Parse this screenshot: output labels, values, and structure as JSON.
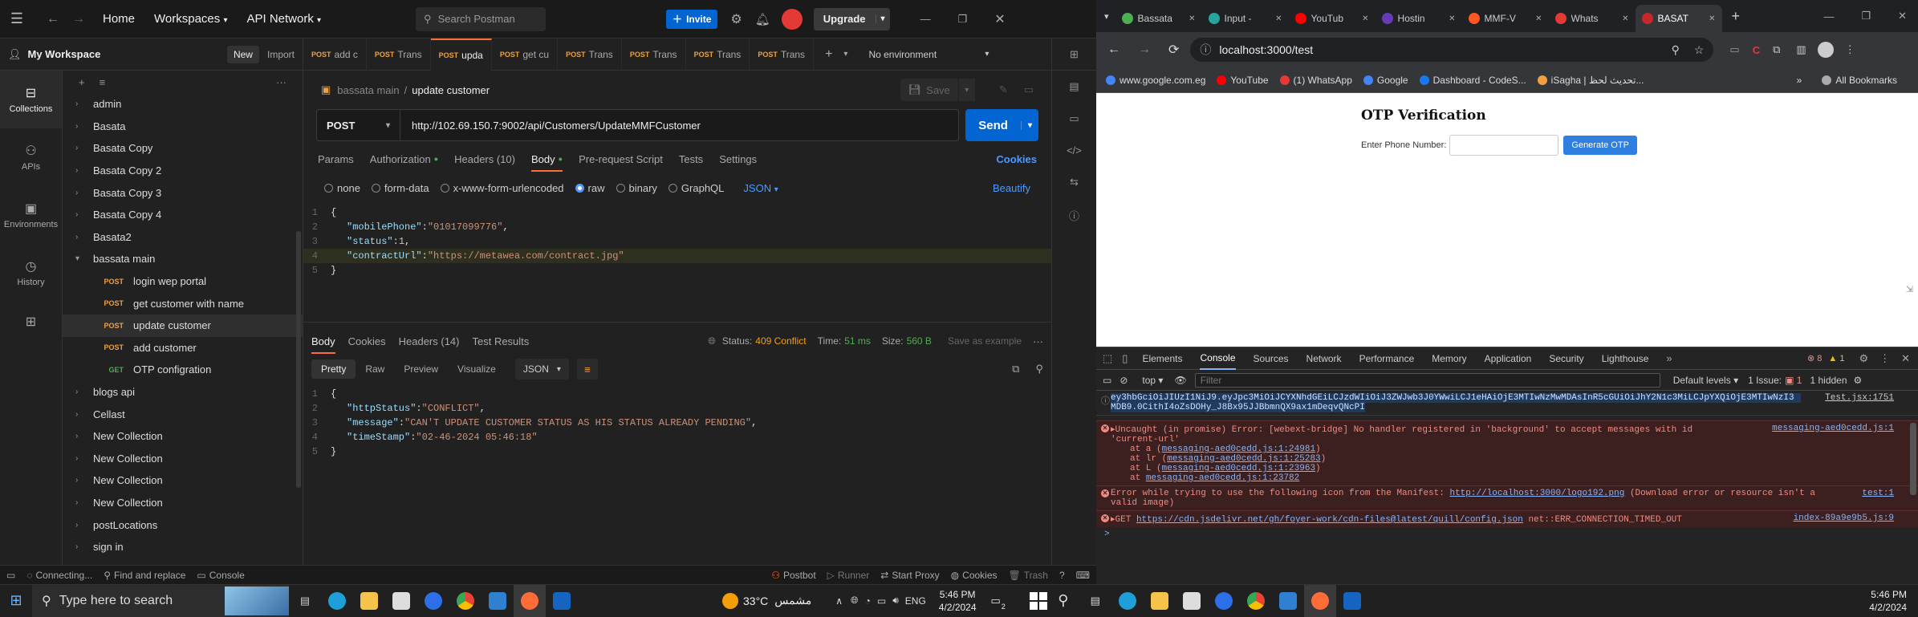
{
  "postman": {
    "nav": {
      "home": "Home",
      "workspaces": "Workspaces",
      "api_network": "API Network",
      "search_placeholder": "Search Postman",
      "invite": "Invite",
      "upgrade": "Upgrade"
    },
    "workspace": {
      "name": "My Workspace",
      "new": "New",
      "import": "Import",
      "environment": "No environment"
    },
    "tabs": [
      {
        "method": "POST",
        "label": "add c"
      },
      {
        "method": "POST",
        "label": "Trans"
      },
      {
        "method": "POST",
        "label": "upda"
      },
      {
        "method": "POST",
        "label": "get cu"
      },
      {
        "method": "POST",
        "label": "Trans"
      },
      {
        "method": "POST",
        "label": "Trans"
      },
      {
        "method": "POST",
        "label": "Trans"
      },
      {
        "method": "POST",
        "label": "Trans"
      }
    ],
    "rail": [
      {
        "label": "Collections",
        "icon": "collections-icon"
      },
      {
        "label": "APIs",
        "icon": "apis-icon"
      },
      {
        "label": "Environments",
        "icon": "environments-icon"
      },
      {
        "label": "History",
        "icon": "history-icon"
      },
      {
        "label": "",
        "icon": "add-apps-icon"
      }
    ],
    "tree": [
      {
        "label": "admin",
        "type": "folder"
      },
      {
        "label": "Basata",
        "type": "folder"
      },
      {
        "label": "Basata Copy",
        "type": "folder"
      },
      {
        "label": "Basata Copy 2",
        "type": "folder"
      },
      {
        "label": "Basata Copy 3",
        "type": "folder"
      },
      {
        "label": "Basata Copy 4",
        "type": "folder"
      },
      {
        "label": "Basata2",
        "type": "folder"
      },
      {
        "label": "bassata main",
        "type": "open"
      },
      {
        "label": "login wep portal",
        "type": "child",
        "method": "POST"
      },
      {
        "label": "get customer with name",
        "type": "child",
        "method": "POST"
      },
      {
        "label": "update customer",
        "type": "child",
        "method": "POST",
        "selected": true
      },
      {
        "label": "add customer",
        "type": "child",
        "method": "POST"
      },
      {
        "label": "OTP configration",
        "type": "child",
        "method": "GET"
      },
      {
        "label": "blogs api",
        "type": "folder"
      },
      {
        "label": "Cellast",
        "type": "folder"
      },
      {
        "label": "New Collection",
        "type": "folder"
      },
      {
        "label": "New Collection",
        "type": "folder"
      },
      {
        "label": "New Collection",
        "type": "folder"
      },
      {
        "label": "New Collection",
        "type": "folder"
      },
      {
        "label": "postLocations",
        "type": "folder"
      },
      {
        "label": "sign in",
        "type": "folder"
      }
    ],
    "request": {
      "breadcrumb_parent": "bassata main",
      "breadcrumb_sep": "/",
      "name": "update customer",
      "save": "Save",
      "method": "POST",
      "url": "http://102.69.150.7:9002/api/Customers/UpdateMMFCustomer",
      "send": "Send",
      "subtabs": [
        "Params",
        "Authorization",
        "Headers (10)",
        "Body",
        "Pre-request Script",
        "Tests",
        "Settings"
      ],
      "cookies": "Cookies",
      "body_modes": [
        "none",
        "form-data",
        "x-www-form-urlencoded",
        "raw",
        "binary",
        "GraphQL"
      ],
      "body_lang": "JSON",
      "beautify": "Beautify",
      "body_lines": [
        {
          "n": "1",
          "text": "{"
        },
        {
          "n": "2",
          "key": "\"mobilePhone\"",
          "val": "\"01017099776\"",
          "trail": ","
        },
        {
          "n": "3",
          "key": "\"status\"",
          "num": "1",
          "trail": ","
        },
        {
          "n": "4",
          "key": "\"contractUrl\"",
          "val": "\"https://metawea.com/contract.jpg\"",
          "trail": ""
        },
        {
          "n": "5",
          "text": "}"
        }
      ]
    },
    "response": {
      "tabs": [
        "Body",
        "Cookies",
        "Headers (14)",
        "Test Results"
      ],
      "status_label": "Status:",
      "status": "409 Conflict",
      "time_label": "Time:",
      "time": "51 ms",
      "size_label": "Size:",
      "size": "560 B",
      "save_example": "Save as example",
      "views": [
        "Pretty",
        "Raw",
        "Preview",
        "Visualize"
      ],
      "format": "JSON",
      "lines": [
        {
          "n": "1",
          "text": "{"
        },
        {
          "n": "2",
          "key": "\"httpStatus\"",
          "val": "\"CONFLICT\"",
          "trail": ","
        },
        {
          "n": "3",
          "key": "\"message\"",
          "val": "\"CAN'T UPDATE CUSTOMER STATUS AS HIS STATUS ALREADY PENDING\"",
          "trail": ","
        },
        {
          "n": "4",
          "key": "\"timeStamp\"",
          "val": "\"02-46-2024  05:46:18\"",
          "trail": ""
        },
        {
          "n": "5",
          "text": "}"
        }
      ]
    },
    "status_bar": {
      "connecting": "Connecting...",
      "find": "Find and replace",
      "console": "Console",
      "postbot": "Postbot",
      "runner": "Runner",
      "proxy": "Start Proxy",
      "cookies": "Cookies",
      "trash": "Trash"
    }
  },
  "chrome": {
    "tabs": [
      {
        "label": "Bassata",
        "color": "#4caf50"
      },
      {
        "label": "Input -",
        "color": "#26a69a"
      },
      {
        "label": "YouTub",
        "color": "#ff0000"
      },
      {
        "label": "Hostin",
        "color": "#673ab7"
      },
      {
        "label": "MMF-V",
        "color": "#ff5722"
      },
      {
        "label": "Whats",
        "color": "#e53935"
      },
      {
        "label": "BASAT",
        "color": "#c62828"
      }
    ],
    "url": "localhost:3000/test",
    "bookmarks": [
      "www.google.com.eg",
      "YouTube",
      "(1) WhatsApp",
      "Google",
      "Dashboard - CodeS...",
      "iSagha | تحديث لحظ...",
      "All Bookmarks"
    ],
    "page": {
      "title": "OTP Verification",
      "phone_label": "Enter Phone Number:",
      "button": "Generate OTP"
    },
    "devtools": {
      "tabs": [
        "Elements",
        "Console",
        "Sources",
        "Network",
        "Performance",
        "Memory",
        "Application",
        "Security",
        "Lighthouse"
      ],
      "errors": "8",
      "warnings": "1",
      "context": "top",
      "filter_placeholder": "Filter",
      "levels": "Default levels",
      "issues": "1 Issue:",
      "issue_count": "1",
      "hidden": "1 hidden",
      "token_line1": "ey3hbGciOiJIUzI1NiJ9.eyJpc3MiOiJCYXNhdGEiLCJzdWIiOiJ3ZWJwb3J0YWwiLCJ1eHAiOjE3MTIwNzMwMDAsInR5cGUiOiJhY2N1c3MiLCJpYXQiOjE3MTIwNzI3",
      "token_line2": "MDB9.0CithI4oZsDOHy_J8Bx95JJBbmnQX9ax1mDeqvQNcPI",
      "token_src": "Test.jsx:1751",
      "err1_text": "Uncaught (in promise) Error: [webext-bridge] No handler registered in 'background' to accept messages with id",
      "err1_text2": "'current-url'",
      "err1_src": "messaging-aed0cedd.js:1",
      "stack": [
        {
          "fn": "at a",
          "loc": "messaging-aed0cedd.js:1:24981"
        },
        {
          "fn": "at lr",
          "loc": "messaging-aed0cedd.js:1:25283"
        },
        {
          "fn": "at L",
          "loc": "messaging-aed0cedd.js:1:23963"
        },
        {
          "fn": "at",
          "loc": "messaging-aed0cedd.js:1:23782"
        }
      ],
      "err2_text": "Error while trying to use the following icon from the Manifest:",
      "err2_link": "http://localhost:3000/logo192.png",
      "err2_rest": "(Download error or resource isn't a",
      "err2_text2": "valid image)",
      "err2_src": "test:1",
      "err3_method": "GET",
      "err3_link": "https://cdn.jsdelivr.net/gh/foyer-work/cdn-files@latest/quill/config.json",
      "err3_rest": "net::ERR_CONNECTION_TIMED_OUT",
      "err3_src": "index-89a9e9b5.js:9",
      "prompt": ">"
    }
  },
  "taskbar": {
    "search_placeholder": "Type here to search",
    "weather": "33°C",
    "weather_desc": "مشمس",
    "lang": "ENG",
    "left_time": "5:46 PM",
    "left_date": "4/2/2024",
    "right_time": "5:46 PM",
    "right_date": "4/2/2024",
    "notif": "2"
  }
}
